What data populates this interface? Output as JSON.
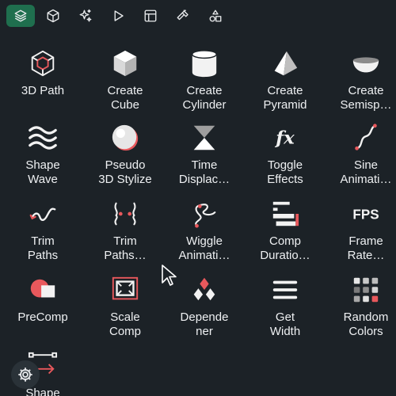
{
  "toolbar": {
    "buttons": [
      {
        "icon": "layers-icon",
        "active": true
      },
      {
        "icon": "cube-icon",
        "active": false
      },
      {
        "icon": "sparkles-icon",
        "active": false
      },
      {
        "icon": "play-icon",
        "active": false
      },
      {
        "icon": "layout-icon",
        "active": false
      },
      {
        "icon": "hammer-icon",
        "active": false
      },
      {
        "icon": "shapes-icon",
        "active": false
      }
    ]
  },
  "items": [
    {
      "label": "3D Path",
      "icon": "3d-path-icon"
    },
    {
      "label": "Create\nCube",
      "icon": "cube-icon"
    },
    {
      "label": "Create\nCylinder",
      "icon": "cylinder-icon"
    },
    {
      "label": "Create\nPyramid",
      "icon": "pyramid-icon"
    },
    {
      "label": "Create\nSemisp…",
      "icon": "semisphere-icon"
    },
    {
      "label": "Shape\nWave",
      "icon": "wave-icon"
    },
    {
      "label": "Pseudo\n3D Stylize",
      "icon": "sphere-icon"
    },
    {
      "label": "Time\nDisplac…",
      "icon": "hourglass-icon"
    },
    {
      "label": "Toggle\nEffects",
      "icon": "fx-icon"
    },
    {
      "label": "Sine\nAnimati…",
      "icon": "sine-icon"
    },
    {
      "label": "Trim\nPaths",
      "icon": "trim-paths-icon"
    },
    {
      "label": "Trim\nPaths…",
      "icon": "trim-paths-multi-icon"
    },
    {
      "label": "Wiggle\nAnimati…",
      "icon": "wiggle-icon"
    },
    {
      "label": "Comp\nDuratio…",
      "icon": "comp-duration-icon"
    },
    {
      "label": "Frame\nRate…",
      "icon": "fps-icon"
    },
    {
      "label": "PreComp",
      "icon": "precomp-icon"
    },
    {
      "label": "Scale\nComp",
      "icon": "scale-comp-icon"
    },
    {
      "label": "Depende\nner",
      "icon": "dependener-icon"
    },
    {
      "label": "Get\nWidth",
      "icon": "get-width-icon"
    },
    {
      "label": "Random\nColors",
      "icon": "random-colors-icon"
    },
    {
      "label": "Shape",
      "icon": "shape-arrow-icon"
    }
  ],
  "fps_text": "FPS",
  "fx_text": "fx",
  "colors": {
    "background": "#1c2227",
    "accent": "#1f6f4e",
    "highlight": "#e8585c",
    "icon": "#f2f2f2"
  }
}
